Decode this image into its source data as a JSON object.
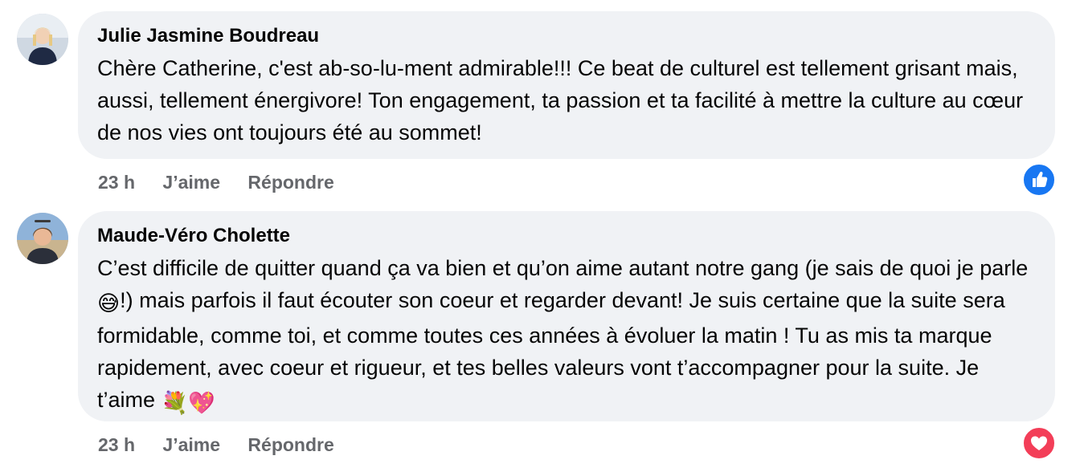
{
  "comments": [
    {
      "author": "Julie Jasmine Boudreau",
      "text": "Chère Catherine, c'est ab-so-lu-ment admirable!!! Ce beat de culturel est tellement grisant mais, aussi, tellement énergivore! Ton engagement, ta passion et ta facilité à mettre la culture au cœur de nos vies ont toujours été au sommet!",
      "time": "23 h",
      "like_label": "J’aime",
      "reply_label": "Répondre",
      "reaction": "like-icon",
      "reaction_color": "#1877f2"
    },
    {
      "author": "Maude-Véro Cholette",
      "text_part1": "C’est difficile de quitter quand ça va bien et qu’on aime autant notre gang (je sais de quoi je parle ",
      "emoji1": "😅",
      "text_part2": "!) mais parfois il faut écouter son coeur et regarder devant! Je suis certaine que la suite sera formidable, comme toi, et comme toutes ces années à évoluer la matin ! Tu as mis ta marque rapidement, avec coeur et rigueur, et tes belles valeurs vont t’accompagner pour la suite. Je t’aime ",
      "emoji2": "💐💖",
      "time": "23 h",
      "like_label": "J’aime",
      "reply_label": "Répondre",
      "reaction": "love-icon",
      "reaction_color": "#f33e58"
    }
  ],
  "colors": {
    "bubble": "#f0f2f5",
    "meta_text": "#65676b",
    "text": "#050505"
  }
}
